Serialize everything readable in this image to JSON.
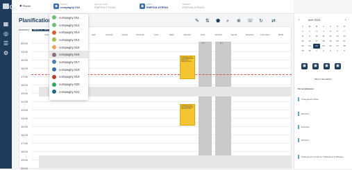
{
  "topbar": {
    "planner_label": "Planer",
    "societe_label": "Société",
    "societe_value": "compagny 016",
    "fonds_label": "Fond de vente",
    "fonds_value": "EMP016-FTU061",
    "atelier_label": "Atelier",
    "atelier_value": "EMP016-ATE063",
    "magasin_label": "Magasin",
    "magasin_value": "EMP016-ATE063"
  },
  "page": {
    "title": "Planification-24",
    "date_range": "24/06/2024",
    "effectifs_label": "Effectifs (10 - 20/24)",
    "hours": [
      "00:00",
      "14:00",
      "15:00",
      "16:00",
      "17:00",
      "18:00",
      "19:00",
      "12:00",
      "13:00",
      "14:00",
      "15:00",
      "16:00",
      "17:00",
      "18:00",
      "19:00",
      "20:00"
    ],
    "columns": [
      "Lundi",
      "Mardi",
      "Mercredi",
      "Jeudi",
      "Vendredi",
      "Samedi",
      "Dimanche",
      "Lundi",
      "Mardi",
      "Mercredi",
      "Jeudi",
      "Vendredi",
      "Samedi",
      "Dimanche",
      "Férié Ouvré",
      "Réduit",
      "Défini"
    ],
    "column_markers": [
      "P 1",
      "P 1"
    ],
    "event1": "9 RENDEZ-VOUS DE PREPARATION VEHICULE RENDEZ-VOUS",
    "event2": "9 RENDEZ-VOUS DE PREPARATION VEHICULE RDV"
  },
  "dropdown": {
    "items": [
      {
        "label": "compagny 011",
        "color": "#6cc070"
      },
      {
        "label": "compagny 012",
        "color": "#6cc070"
      },
      {
        "label": "compagny 013",
        "color": "#e4572e"
      },
      {
        "label": "compagny 014",
        "color": "#9bc53d"
      },
      {
        "label": "compagny 015",
        "color": "#f4a259"
      },
      {
        "label": "compagny 016",
        "color": "#8e6c88"
      },
      {
        "label": "compagny 017",
        "color": "#4a7fb5"
      },
      {
        "label": "compagny 018",
        "color": "#3e6fb0"
      },
      {
        "label": "compagny 019",
        "color": "#c0392b"
      },
      {
        "label": "compagny 020",
        "color": "#27ae60"
      },
      {
        "label": "compagny 021",
        "color": "#1f6b8f"
      }
    ],
    "selected_index": 5
  },
  "calendar": {
    "month": "avril 2024",
    "weekdays": [
      "L",
      "M",
      "M",
      "J",
      "V",
      "S",
      "D"
    ],
    "weeks": [
      [
        "1",
        "2",
        "3",
        "4",
        "5",
        "6",
        "7"
      ],
      [
        "8",
        "9",
        "10",
        "11",
        "12",
        "13",
        "14"
      ],
      [
        "15",
        "16",
        "17",
        "18",
        "19",
        "20",
        "21"
      ],
      [
        "22",
        "23",
        "24",
        "25",
        "26",
        "27",
        "28"
      ],
      [
        "29",
        "30",
        "1",
        "2",
        "3",
        "4",
        "5"
      ]
    ],
    "selected_day": "24"
  },
  "right_panel": {
    "filter_label": "Filtrer informations",
    "section_label": "Un ou plusieurs",
    "rows": [
      "Changement Boite",
      "Révision",
      "Entretien",
      "Révision",
      "Changement Courroie / Plaquettes & Disques"
    ]
  },
  "colors": {
    "sidebar": "#1f3b5c",
    "accent": "#2a4b8d",
    "event": "#f5c431",
    "gray_col": "#c9c9c9"
  }
}
